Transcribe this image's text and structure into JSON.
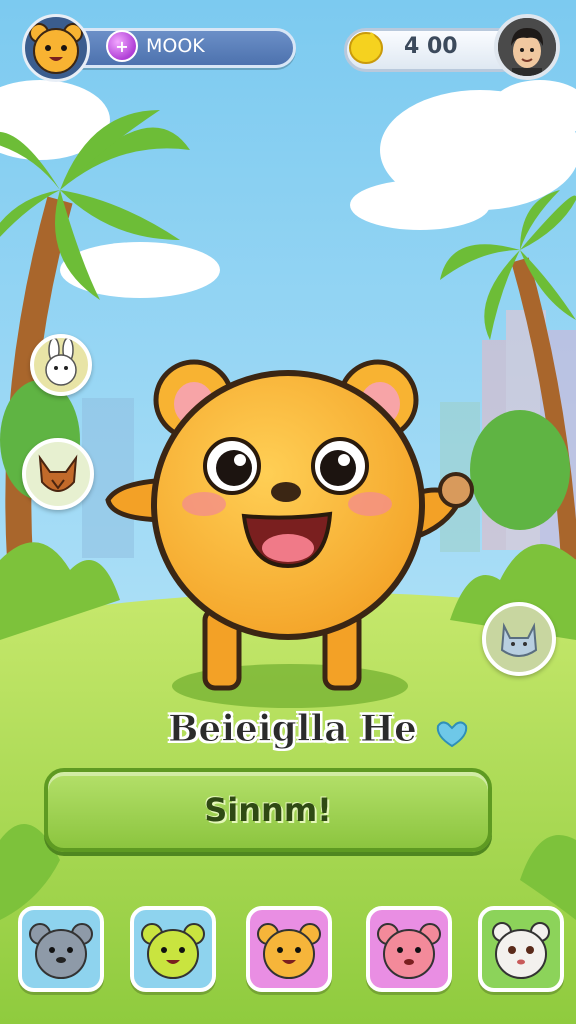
{
  "hud": {
    "currency_label": "MOOK",
    "gem_glyph": "+",
    "coins_text": "4 00"
  },
  "character": {
    "name": "Beieiglla He"
  },
  "action": {
    "button_label": "Sinnm!"
  },
  "side_pets": [
    {
      "name": "white-bunny",
      "color": "#e8e4a6"
    },
    {
      "name": "brown-fox",
      "color": "#e7f0d0"
    },
    {
      "name": "blue-cat",
      "color": "#c8d6a0"
    }
  ],
  "tray": [
    {
      "name": "gray-bear",
      "bg": "#8ed3ee",
      "color": "#8e9aa8"
    },
    {
      "name": "green-bear",
      "bg": "#8ed3ee",
      "color": "#c9e43f"
    },
    {
      "name": "orange-bear",
      "bg": "#e98ee3",
      "color": "#f6b53a"
    },
    {
      "name": "pink-bear",
      "bg": "#e98ee3",
      "color": "#f38a9a"
    },
    {
      "name": "white-bunny",
      "bg": "#8cd35a",
      "color": "#f3f1ee"
    }
  ],
  "colors": {
    "sky": "#8fd3f4",
    "grass": "#a8dc56",
    "hero": "#f8b332",
    "button": "#9ccf4b"
  }
}
